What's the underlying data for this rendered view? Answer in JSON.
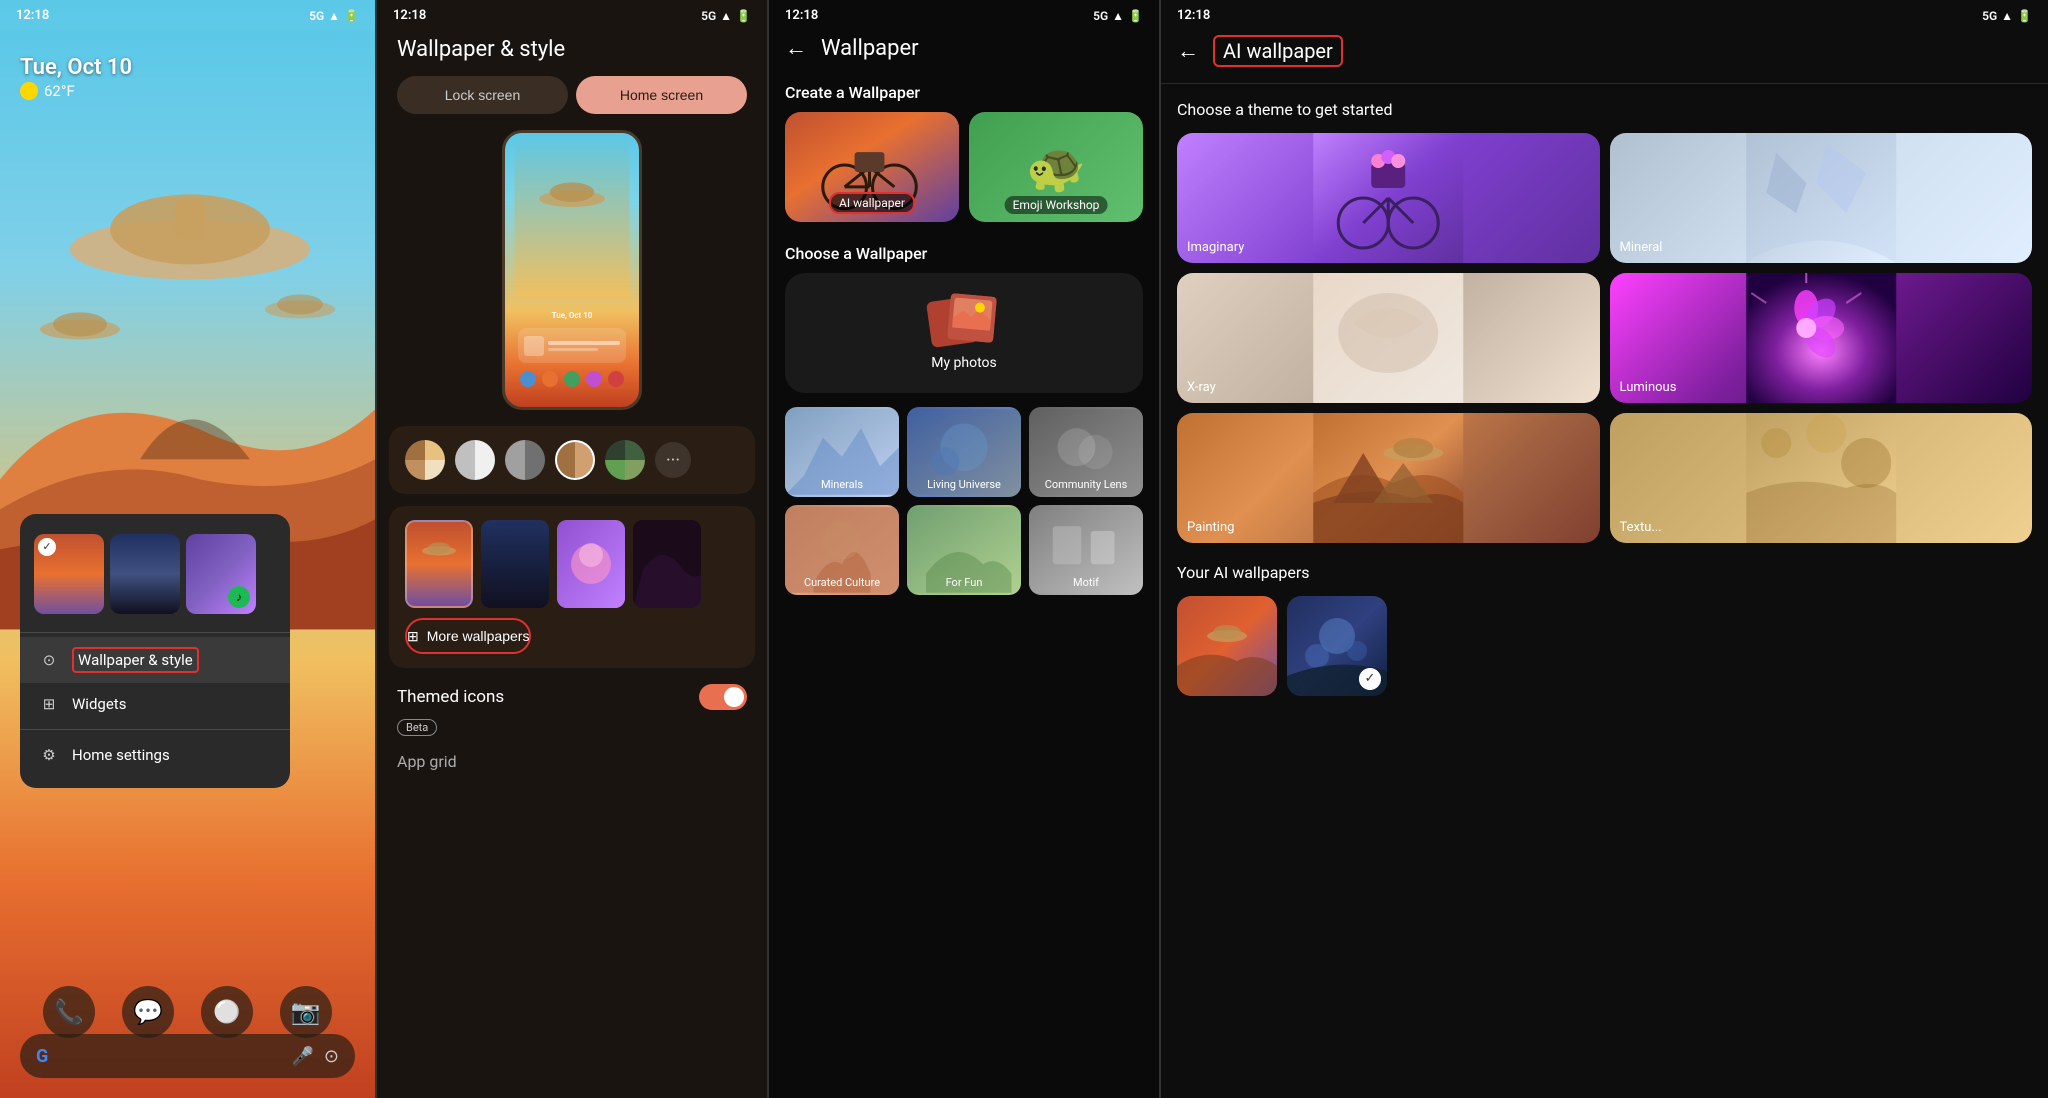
{
  "panel1": {
    "status": {
      "time": "12:18",
      "network": "5G",
      "icons": "📶🔋"
    },
    "date": "Tue, Oct 10",
    "weather": "62°F",
    "menu": {
      "items": [
        {
          "id": "wallpaper-style",
          "icon": "⊙",
          "label": "Wallpaper & style",
          "highlighted": true
        },
        {
          "id": "widgets",
          "icon": "⊞",
          "label": "Widgets",
          "highlighted": false
        },
        {
          "id": "home-settings",
          "icon": "⚙",
          "label": "Home settings",
          "highlighted": false
        }
      ]
    },
    "dock": {
      "icons": [
        "📞",
        "💬",
        "⚪",
        "📷"
      ]
    },
    "search": {
      "logo": "G"
    }
  },
  "panel2": {
    "status": {
      "time": "12:18",
      "network": "5G"
    },
    "title": "Wallpaper & style",
    "tabs": [
      {
        "id": "lock-screen",
        "label": "Lock screen",
        "active": false
      },
      {
        "id": "home-screen",
        "label": "Home screen",
        "active": true
      }
    ],
    "more_wallpapers_btn": "More wallpapers",
    "themed_icons": {
      "label": "Themed icons",
      "badge": "Beta"
    },
    "app_grid_label": "App grid"
  },
  "panel3": {
    "status": {
      "time": "12:18",
      "network": "5G"
    },
    "title": "Wallpaper",
    "sections": {
      "create": "Create a Wallpaper",
      "choose": "Choose a Wallpaper"
    },
    "create_cards": [
      {
        "id": "ai-wallpaper",
        "label": "AI wallpaper",
        "highlighted": true
      },
      {
        "id": "emoji-workshop",
        "label": "Emoji Workshop",
        "highlighted": false
      }
    ],
    "my_photos": "My photos",
    "grid_items": [
      {
        "id": "minerals",
        "label": "Minerals"
      },
      {
        "id": "living-universe",
        "label": "Living Universe"
      },
      {
        "id": "community-lens",
        "label": "Community Lens"
      },
      {
        "id": "curated-culture",
        "label": "Curated Culture"
      },
      {
        "id": "for-fun",
        "label": "For Fun"
      },
      {
        "id": "motif",
        "label": "Motif"
      }
    ]
  },
  "panel4": {
    "status": {
      "time": "12:18",
      "network": "5G"
    },
    "title": "AI wallpaper",
    "choose_label": "Choose a theme to get started",
    "themes": [
      {
        "id": "imaginary",
        "label": "Imaginary"
      },
      {
        "id": "mineral",
        "label": "Mineral"
      },
      {
        "id": "xray",
        "label": "X-ray"
      },
      {
        "id": "luminous",
        "label": "Luminous"
      },
      {
        "id": "painting",
        "label": "Painting"
      },
      {
        "id": "texture",
        "label": "Textu..."
      }
    ],
    "your_ai_label": "Your AI wallpapers"
  }
}
